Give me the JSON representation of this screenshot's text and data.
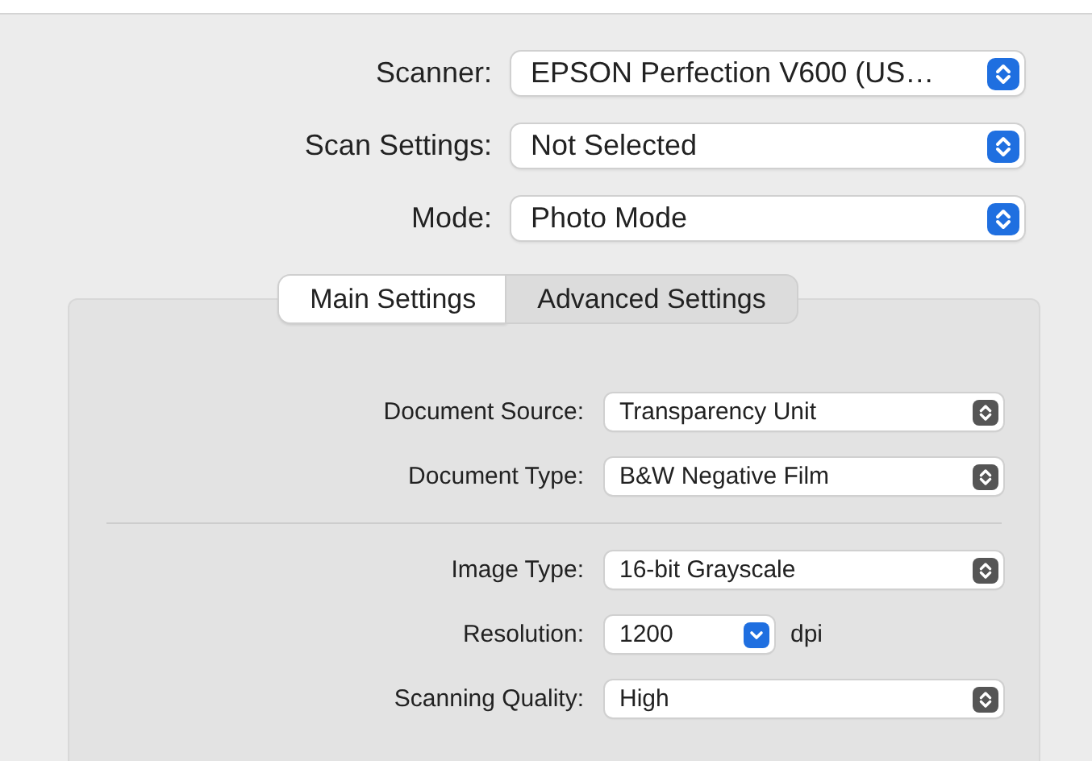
{
  "scanner_fields": [
    {
      "label": "Scanner:",
      "value": "EPSON Perfection V600 (US…"
    },
    {
      "label": "Scan Settings:",
      "value": "Not Selected"
    },
    {
      "label": "Mode:",
      "value": "Photo Mode"
    }
  ],
  "tabs": [
    {
      "label": "Main Settings",
      "selected": true
    },
    {
      "label": "Advanced Settings",
      "selected": false
    }
  ],
  "main_settings": {
    "groups": [
      [
        {
          "kind": "popup",
          "label": "Document Source:",
          "value": "Transparency Unit"
        },
        {
          "kind": "popup",
          "label": "Document Type:",
          "value": "B&W Negative Film"
        }
      ],
      [
        {
          "kind": "popup",
          "label": "Image Type:",
          "value": "16-bit Grayscale"
        },
        {
          "kind": "pulldown",
          "label": "Resolution:",
          "value": "1200",
          "unit": "dpi"
        },
        {
          "kind": "popup",
          "label": "Scanning Quality:",
          "value": "High"
        }
      ]
    ]
  }
}
